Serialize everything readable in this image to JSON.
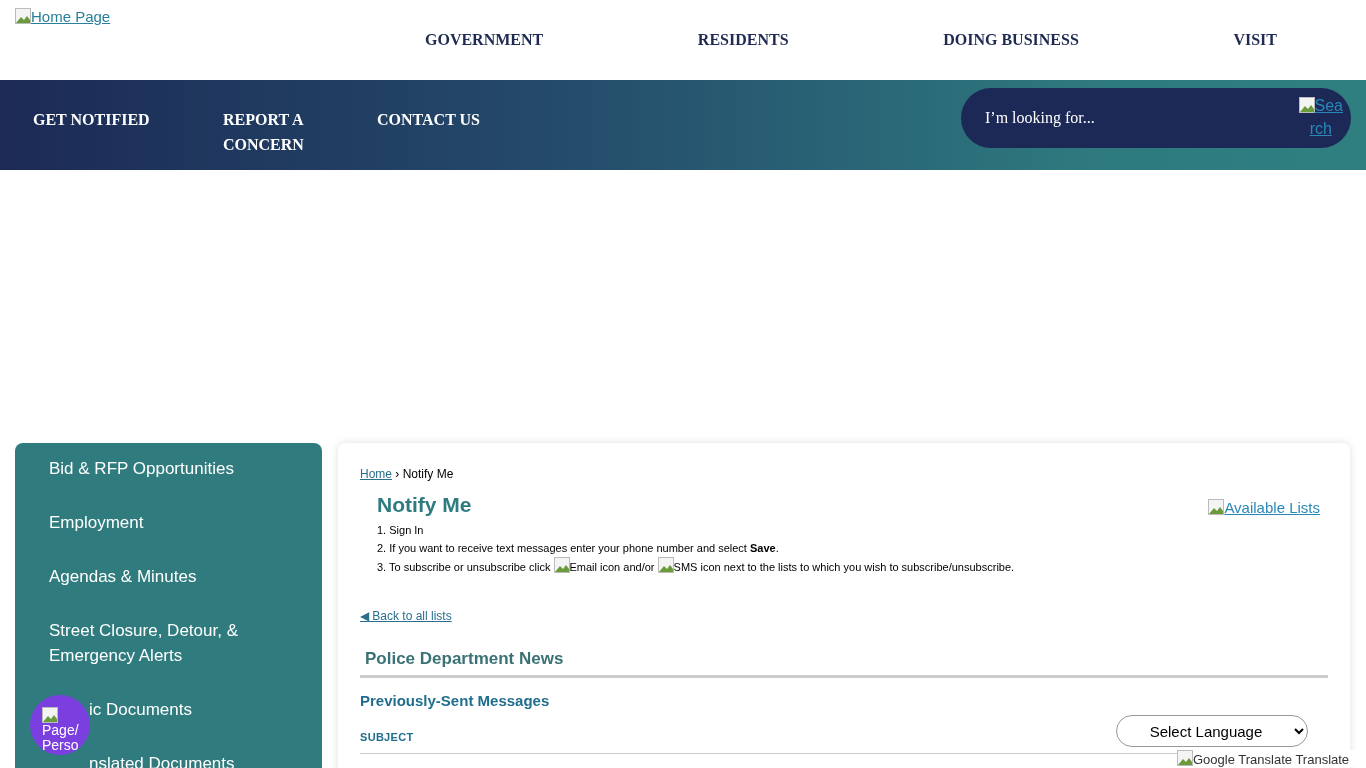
{
  "logo": {
    "alt": "Home Page"
  },
  "main_nav": [
    "GOVERNMENT",
    "RESIDENTS",
    "DOING BUSINESS",
    "VISIT"
  ],
  "quick_links": [
    "GET NOTIFIED",
    "REPORT A CONCERN",
    "CONTACT US"
  ],
  "search": {
    "placeholder": "I’m looking for...",
    "button_alt_1": "Sea",
    "button_alt_2": "rch"
  },
  "sidebar": {
    "items": [
      {
        "label": "Bid & RFP Opportunities"
      },
      {
        "label": "Employment"
      },
      {
        "label": "Agendas & Minutes"
      },
      {
        "label": "Street Closure, Detour, & Emergency Alerts"
      },
      {
        "label": "ic Documents"
      },
      {
        "label": "nslated Documents"
      }
    ]
  },
  "widget": {
    "line_1": "Page/",
    "line_2": "Perso"
  },
  "breadcrumb": {
    "home": "Home",
    "separator": "›",
    "current": "Notify Me"
  },
  "title": "Notify Me",
  "available_lists": "Available Lists",
  "steps": [
    "1. Sign In",
    "2. If you want to receive text messages enter your phone number and select **Save**.",
    {
      "before": "3. To subscribe or unsubscribe click",
      "email": "Email icon",
      "middle": "and/or",
      "sms": "SMS icon",
      "after": "next to the lists to which you wish to subscribe/unsubscribe."
    }
  ],
  "back_link": "◀ Back to all lists",
  "list_title": "Police Department News",
  "messages_heading": "Previously-Sent Messages",
  "table": {
    "columns": [
      "SUBJECT"
    ]
  },
  "language": {
    "value": "Select Language",
    "powered_alt": "Google Translate",
    "powered_label": "Translate"
  }
}
